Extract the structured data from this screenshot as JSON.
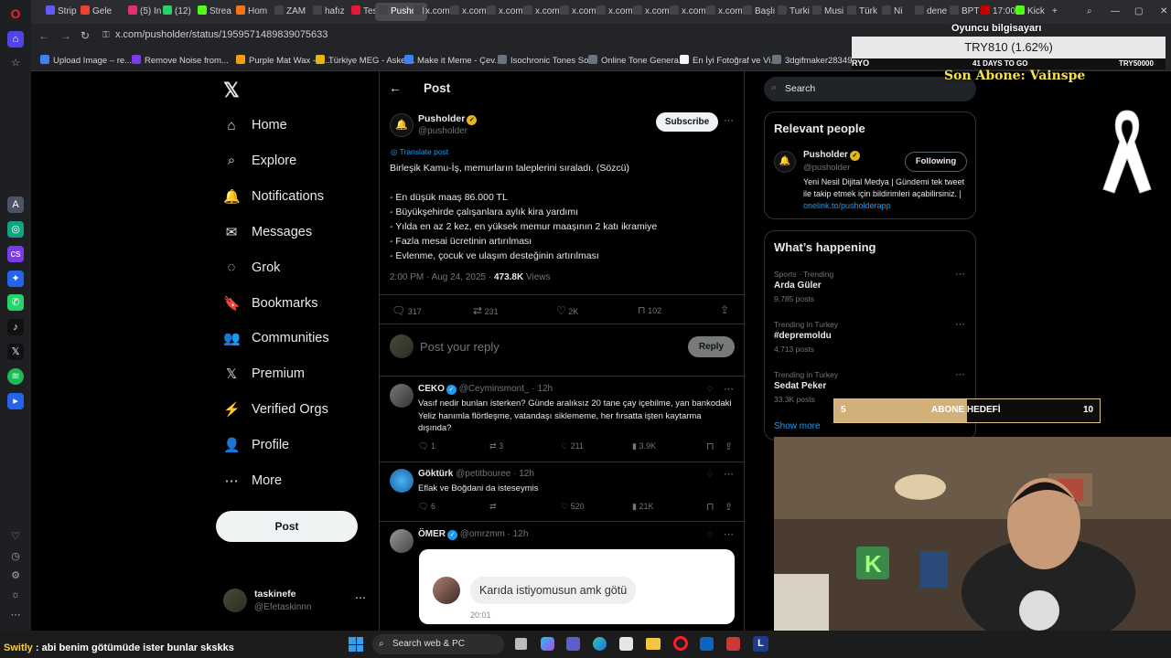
{
  "browser": {
    "tabs": [
      {
        "label": "Strip",
        "color": "#635bff"
      },
      {
        "label": "Gele",
        "color": "#ea4335"
      },
      {
        "label": "(5) In",
        "color": "#e1306c"
      },
      {
        "label": "(12)",
        "color": "#25d366"
      },
      {
        "label": "Strea",
        "color": "#53fc18"
      },
      {
        "label": "Hom",
        "color": "#f97316"
      },
      {
        "label": "ZAM",
        "color": "#444"
      },
      {
        "label": "hafız",
        "color": "#444"
      },
      {
        "label": "Tesla",
        "color": "#e31937"
      },
      {
        "label": "Pushold",
        "color": "#444"
      },
      {
        "label": "x.com",
        "color": "#444"
      },
      {
        "label": "x.com",
        "color": "#444"
      },
      {
        "label": "x.com",
        "color": "#444"
      },
      {
        "label": "x.com",
        "color": "#444"
      },
      {
        "label": "x.com",
        "color": "#444"
      },
      {
        "label": "x.com",
        "color": "#444"
      },
      {
        "label": "x.com",
        "color": "#444"
      },
      {
        "label": "x.com",
        "color": "#444"
      },
      {
        "label": "x.com",
        "color": "#444"
      },
      {
        "label": "Başlı",
        "color": "#444"
      },
      {
        "label": "Turki",
        "color": "#444"
      },
      {
        "label": "Musi",
        "color": "#444"
      },
      {
        "label": "Türk",
        "color": "#444"
      },
      {
        "label": "Ni",
        "color": "#444"
      },
      {
        "label": "dene",
        "color": "#444"
      },
      {
        "label": "BPT",
        "color": "#444"
      },
      {
        "label": "17:00",
        "color": "#c00"
      },
      {
        "label": "Kick",
        "color": "#53fc18"
      }
    ],
    "url": "x.com/pusholder/status/1959571489839075633",
    "bookmarks": [
      {
        "label": "Upload Image – re...",
        "color": "#3b82f6"
      },
      {
        "label": "Remove Noise from...",
        "color": "#7c3aed"
      },
      {
        "label": "Purple Mat Wax - M...",
        "color": "#f59e0b"
      },
      {
        "label": "Türkiye MEG - Asker...",
        "color": "#eab308"
      },
      {
        "label": "Make it Meme - Çev...",
        "color": "#3b82f6"
      },
      {
        "label": "Isochronic Tones So...",
        "color": "#6b7280"
      },
      {
        "label": "Online Tone Genera...",
        "color": "#6b7280"
      },
      {
        "label": "En İyi Fotoğraf ve Vi...",
        "color": "#f5f5f5"
      },
      {
        "label": "3dgifmaker28349.gi...",
        "color": "#6b7280"
      },
      {
        "label": "3D Gif Maker",
        "color": "#6b7280"
      },
      {
        "label": "Multi TV - 5 haber k",
        "color": "#6b7280"
      }
    ]
  },
  "x_nav": {
    "items": [
      {
        "label": "Home",
        "icon": "⌂"
      },
      {
        "label": "Explore",
        "icon": "⌕"
      },
      {
        "label": "Notifications",
        "icon": "🔔"
      },
      {
        "label": "Messages",
        "icon": "✉"
      },
      {
        "label": "Grok",
        "icon": "◌"
      },
      {
        "label": "Bookmarks",
        "icon": "🔖"
      },
      {
        "label": "Communities",
        "icon": "👥"
      },
      {
        "label": "Premium",
        "icon": "𝕏"
      },
      {
        "label": "Verified Orgs",
        "icon": "⚡"
      },
      {
        "label": "Profile",
        "icon": "👤"
      },
      {
        "label": "More",
        "icon": "⋯"
      }
    ],
    "post_label": "Post",
    "account": {
      "name": "taskinefe",
      "handle": "@Efetaskinnn"
    }
  },
  "post": {
    "header_title": "Post",
    "author_name": "Pusholder",
    "author_handle": "@pusholder",
    "subscribe_label": "Subscribe",
    "translate_label": "Translate post",
    "lines": [
      "Birleşik Kamu-İş, memurların taleplerini sıraladı. (Sözcü)",
      "",
      "- En düşük maaş 86.000 TL",
      "- Büyükşehirde çalışanlara aylık kira yardımı",
      "- Yılda en az 2 kez, en yüksek memur maaşının 2 katı ikramiye",
      "- Fazla mesai ücretinin artırılması",
      "- Evlenme, çocuk ve ulaşım desteğinin artırılması"
    ],
    "time": "2:00 PM · Aug 24, 2025 · ",
    "views": "473.8K",
    "views_label": " Views",
    "replies": "317",
    "reposts": "231",
    "likes": "2K",
    "bookmarks": "102",
    "reply_placeholder": "Post your reply",
    "reply_button": "Reply"
  },
  "replies": [
    {
      "name": "CEKO",
      "handle": "@Ceyminsmont_ · 12h",
      "text": "Vasıf nedir bunları isterken? Günde aralıksız 20 tane çay içebilme, yan bankodaki Yeliz hanımla flörtleşme, vatandaşı siklememe, her fırsatta işten kaytarma dışında?",
      "replies": "1",
      "reposts": "3",
      "likes": "211",
      "views": "3.9K"
    },
    {
      "name": "Göktürk",
      "handle": "@petitbouree · 12h",
      "text": "Eflak ve Boğdani da isteseymis",
      "replies": "6",
      "reposts": "",
      "likes": "520",
      "views": "21K"
    },
    {
      "name": "ÖMER",
      "handle": "@omrzmm · 12h",
      "image_bubble_text": "Karıda istiyomusun amk götü",
      "image_time": "20:01"
    }
  ],
  "right": {
    "search_placeholder": "Search",
    "relevant_title": "Relevant people",
    "person_name": "Pusholder",
    "person_handle": "@pusholder",
    "following_label": "Following",
    "bio": "Yeni Nesil Dijital Medya | Gündemi tek tweet ile takip etmek için bildirimleri açabilirsiniz. | ",
    "bio_link": "onelink.to/pusholderapp",
    "happening_title": "What’s happening",
    "trends": [
      {
        "meta": "Sports · Trending",
        "name": "Arda Güler",
        "posts": "9,785 posts"
      },
      {
        "meta": "Trending in Turkey",
        "name": "#depremoldu",
        "posts": "4,713 posts"
      },
      {
        "meta": "Trending in Turkey",
        "name": "Sedat Peker",
        "posts": "33.3K posts"
      }
    ],
    "show_more": "Show more"
  },
  "overlay": {
    "oyuncu": "Oyuncu bilgisayarı",
    "ticker": "TRY810 (1.62%)",
    "ryo": "RYO",
    "days_to_go": "41 DAYS TO GO",
    "try_goal": "TRY50000",
    "son_abone": "Son Abone: Vainspe",
    "abone_start": "5",
    "abone_label": "ABONE HEDEFİ",
    "abone_end": "10",
    "abone_progress": 0.5,
    "chat_user": "Switly",
    "chat_msg": " : abi benim götümüde ister bunlar skskks"
  },
  "taskbar": {
    "search_placeholder": "Search web & PC"
  }
}
